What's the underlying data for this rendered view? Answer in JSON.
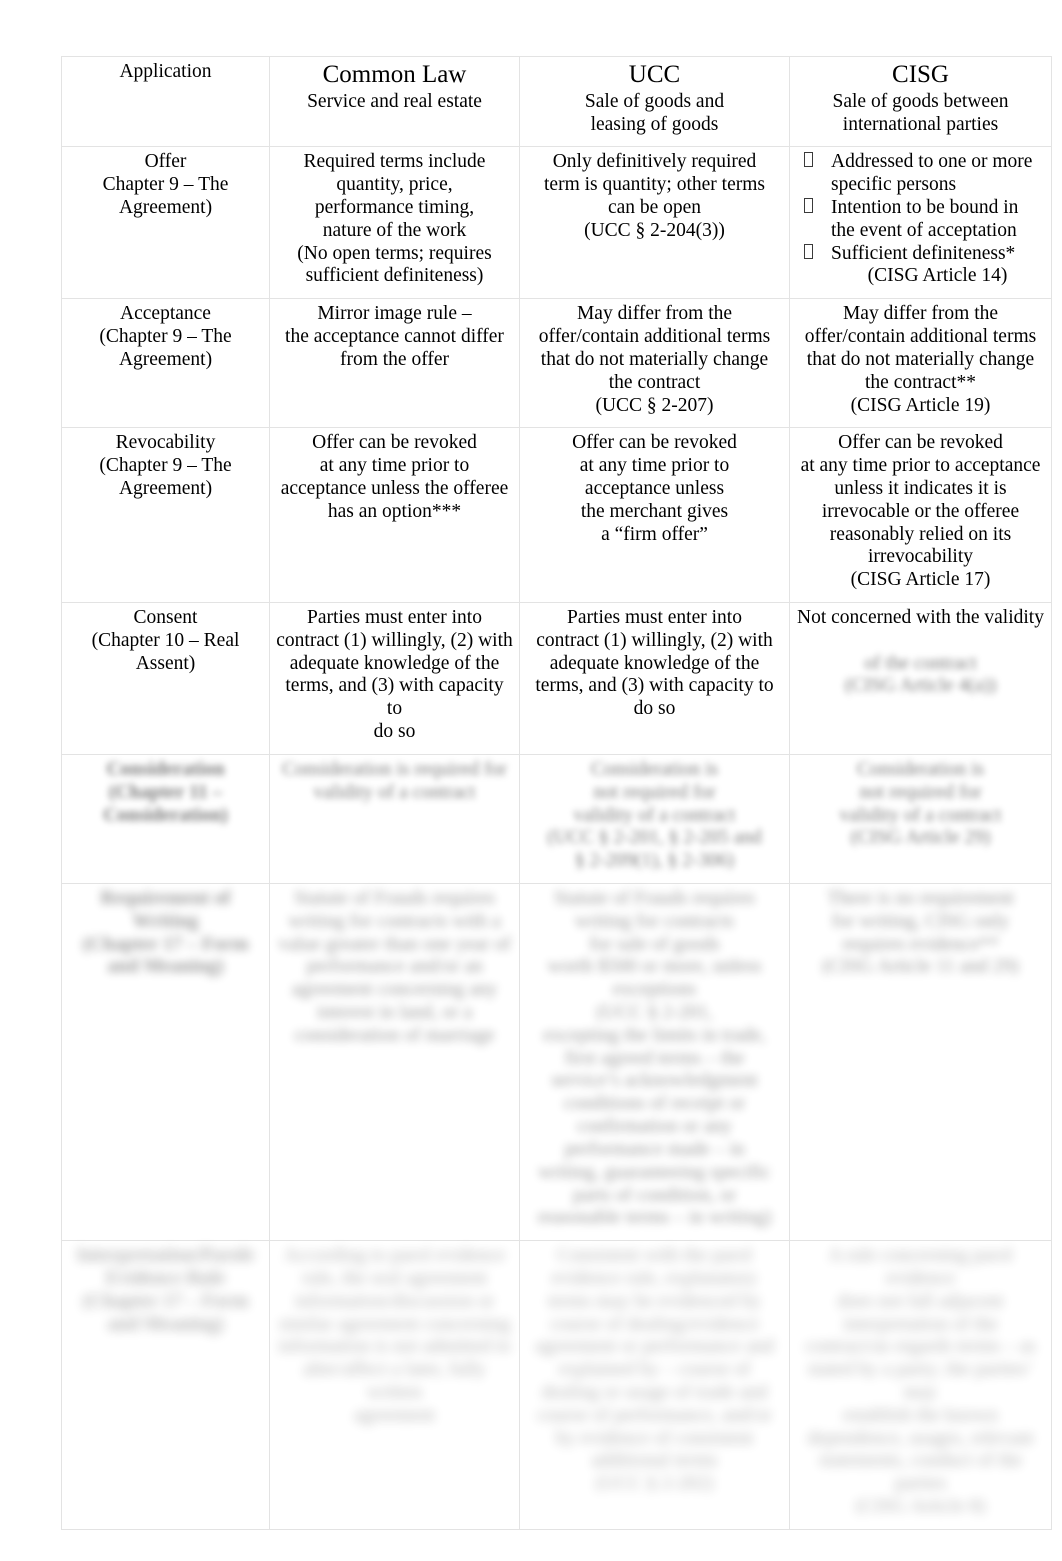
{
  "document": {
    "title": "Common Law / UCC / CISG Contract Formation Comparison Table",
    "background_color": "#ffffff",
    "text_color": "#000000",
    "border_color": "#e3e3e3"
  },
  "table": {
    "columns": [
      {
        "key": "label",
        "header_title": "",
        "header_sub": ""
      },
      {
        "key": "common_law",
        "header_title": "Common Law",
        "header_sub": "Service and real estate"
      },
      {
        "key": "ucc",
        "header_title": "UCC",
        "header_sub": "Sale of goods and\nleasing of goods"
      },
      {
        "key": "cisg",
        "header_title": "CISG",
        "header_sub": "Sale of goods between\ninternational parties"
      }
    ],
    "header_row_label": "Application",
    "rows": [
      {
        "id": "offer",
        "label": "Offer\nChapter 9 – The\nAgreement)",
        "common_law": "Required terms include\nquantity, price,\nperformance timing,\nnature of the work\n(No open terms; requires\nsufficient definiteness)",
        "ucc": "Only definitively required\nterm is quantity; other terms\ncan be open\n(UCC § 2-204(3))",
        "cisg_bullets": [
          "Addressed to one or more specific persons",
          "Intention to be bound in the event of acceptation",
          "Sufficient definiteness*"
        ],
        "cisg_citation": "(CISG Article 14)",
        "blur": "none"
      },
      {
        "id": "acceptance",
        "label": "Acceptance\n(Chapter 9 – The\nAgreement)",
        "common_law": "Mirror image rule –\nthe acceptance cannot differ\nfrom the offer",
        "ucc": "May differ from the\noffer/contain additional terms\nthat do not materially change\nthe contract\n(UCC § 2-207)",
        "cisg": "May differ from the\noffer/contain additional terms\nthat do not materially change\nthe contract**\n(CISG Article 19)",
        "blur": "none"
      },
      {
        "id": "revocability",
        "label": "Revocability\n(Chapter 9 – The\nAgreement)",
        "common_law": "Offer can be revoked\nat any time prior to\nacceptance unless the offeree\nhas an option***",
        "ucc": "Offer can be revoked\nat any time prior to\nacceptance unless\nthe merchant gives\na “firm offer”",
        "cisg": "Offer can be revoked\nat any time prior to acceptance\nunless it indicates it is\nirrevocable or the offeree\nreasonably relied on its\nirrevocability\n(CISG Article 17)",
        "blur": "none"
      },
      {
        "id": "consent",
        "label": "Consent\n(Chapter 10 – Real\nAssent)",
        "common_law": "Parties must enter into\ncontract (1) willingly, (2) with\nadequate knowledge of the\nterms, and (3) with capacity to\ndo so",
        "ucc": "Parties must enter into\ncontract (1) willingly, (2) with\nadequate knowledge of the\nterms, and (3) with capacity to\ndo so",
        "cisg": "Not concerned with the validity\nof the contract\n(CISG Article 4(a))",
        "blur": "partial"
      },
      {
        "id": "consideration",
        "label": "Consideration\n(Chapter 11 –\nConsideration)",
        "common_law": "Consideration is required for\nvalidity of a contract",
        "ucc": "Consideration is\nnot required for\nvalidity of a contract\n(UCC § 2-201, § 2-205 and\n§ 2-209(1), § 2-306)",
        "cisg": "Consideration is\nnot required for\nvalidity of a contract\n(CISG Article 29)",
        "blur": "heavy"
      },
      {
        "id": "requirement_of_writing",
        "label": "Requirement of\nWriting\n(Chapter 17 – Form\nand Meaning)",
        "common_law": "Statute of Frauds requires\nwriting for contracts with a\nvalue greater than one year of\nperformance and/or an\nagreement concerning any\ninterest in land, or a\nconsideration of marriage",
        "ucc": "Statute of Frauds requires\nwriting for contracts\nfor sale of goods\nworth $500 or more, unless\nexceptions\n(UCC § 2-201,\nexcepting the limits in trade,\nfirst agreed terms – the\nservice’s acknowledgment\nconditions of receipt or\nconfirmation or any\nperformance made – in\nwriting, guaranteeing specific\nparts of condition, or\nreasonable terms – in writing)",
        "cisg": "There is no requirement\nfor writing, CISG only\nrequires evidence**\n(CISG Article 11 and 29)",
        "blur": "heavy"
      },
      {
        "id": "interpretation_parol_evidence",
        "label": "Interpretation/Parole\nEvidence Rule\n(Chapter 17 – Form\nand Meaning)",
        "common_law": "According to parol evidence\nrule, the oral agreement\ninformation/discussion or\nsimilar agreement concerning\ninformation is not admitted to\nalter/affect a later, fully written\nagreement",
        "ucc": "Consistent with the parol\nevidence rule, explanatory\nterms may be evidenced by\ncourse of dealing/evidence\nagreement or performance and\nexplained by – course of\ndealing or usage of trade and\ncourse of performance, and/or\nby evidence of consistent\nadditional terms\n(UCC § 2-202)",
        "cisg": "A rule concerning parol evidence\ndoes not fall adjacent\ninterpretation of the\ncontract/as regards terms – as\nstated by a party; the parties’ may\nestablish the known\ndependence, usages, relevant\nstatements, conduct of the\nparties\n(CISG Article 8)",
        "blur": "heavy"
      }
    ]
  }
}
